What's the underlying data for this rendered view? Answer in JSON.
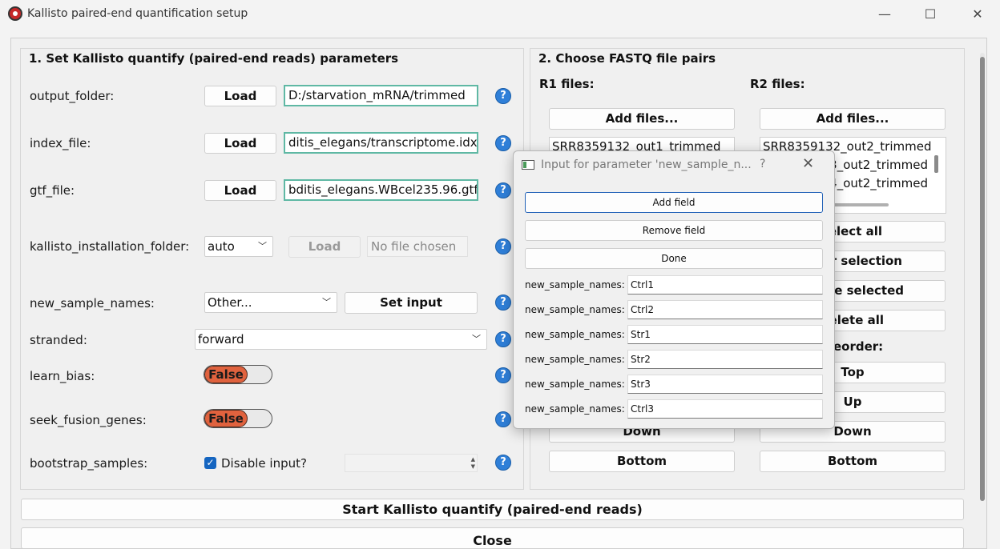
{
  "window": {
    "title": "Kallisto paired-end quantification setup",
    "controls": {
      "minimize": "—",
      "maximize": "☐",
      "close": "✕"
    }
  },
  "params_group": {
    "title": "1. Set Kallisto quantify (paired-end reads) parameters",
    "output_folder": {
      "label": "output_folder:",
      "button": "Load",
      "value": "D:/starvation_mRNA/trimmed"
    },
    "index_file": {
      "label": "index_file:",
      "button": "Load",
      "value": "ditis_elegans/transcriptome.idx"
    },
    "gtf_file": {
      "label": "gtf_file:",
      "button": "Load",
      "value": "bditis_elegans.WBcel235.96.gtf"
    },
    "kallisto_installation_folder": {
      "label": "kallisto_installation_folder:",
      "combo": "auto",
      "button": "Load",
      "value": "No file chosen"
    },
    "new_sample_names": {
      "label": "new_sample_names:",
      "combo": "Other...",
      "button": "Set input"
    },
    "stranded": {
      "label": "stranded:",
      "combo": "forward"
    },
    "learn_bias": {
      "label": "learn_bias:",
      "toggle": "False"
    },
    "seek_fusion_genes": {
      "label": "seek_fusion_genes:",
      "toggle": "False"
    },
    "bootstrap_samples": {
      "label": "bootstrap_samples:",
      "checkbox_label": "Disable input?"
    },
    "help_glyph": "?"
  },
  "fastq_group": {
    "title": "2. Choose FASTQ file pairs",
    "r1": {
      "label": "R1 files:",
      "add_button": "Add files...",
      "items": [
        "SRR8359132_out1_trimmed"
      ],
      "down": "Down",
      "bottom": "Bottom"
    },
    "r2": {
      "label": "R2 files:",
      "add_button": "Add files...",
      "items": [
        "SRR8359132_out2_trimmed",
        "3_out2_trimmed",
        "4_out2_trimmed"
      ],
      "select_all": "elect all",
      "clear_selection": "r selection",
      "delete_selected": "te selected",
      "delete_all": "elete all",
      "reorder": "eorder:",
      "top": "Top",
      "up": "Up",
      "down": "Down",
      "bottom": "Bottom"
    }
  },
  "footer": {
    "start_button": "Start Kallisto quantify (paired-end reads)",
    "close_button": "Close"
  },
  "dialog": {
    "title": "Input for parameter 'new_sample_n...",
    "help": "?",
    "close": "✕",
    "add_field": "Add field",
    "remove_field": "Remove field",
    "done": "Done",
    "fields": [
      {
        "label": "new_sample_names:",
        "value": "Ctrl1"
      },
      {
        "label": "new_sample_names:",
        "value": "Ctrl2"
      },
      {
        "label": "new_sample_names:",
        "value": "Str1"
      },
      {
        "label": "new_sample_names:",
        "value": "Str2"
      },
      {
        "label": "new_sample_names:",
        "value": "Str3"
      },
      {
        "label": "new_sample_names:",
        "value": "Ctrl3"
      }
    ]
  }
}
